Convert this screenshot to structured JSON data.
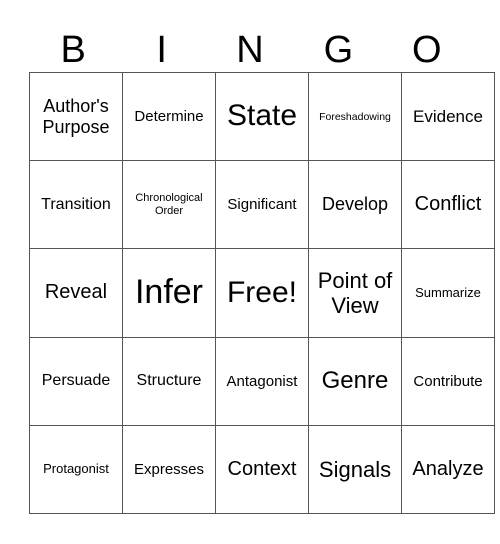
{
  "header": [
    "B",
    "I",
    "N",
    "G",
    "O"
  ],
  "rows": [
    [
      "Author's Purpose",
      "Determine",
      "State",
      "Foreshadowing",
      "Evidence"
    ],
    [
      "Transition",
      "Chronological Order",
      "Significant",
      "Develop",
      "Conflict"
    ],
    [
      "Reveal",
      "Infer",
      "Free!",
      "Point of View",
      "Summarize"
    ],
    [
      "Persuade",
      "Structure",
      "Antagonist",
      "Genre",
      "Contribute"
    ],
    [
      "Protagonist",
      "Expresses",
      "Context",
      "Signals",
      "Analyze"
    ]
  ]
}
